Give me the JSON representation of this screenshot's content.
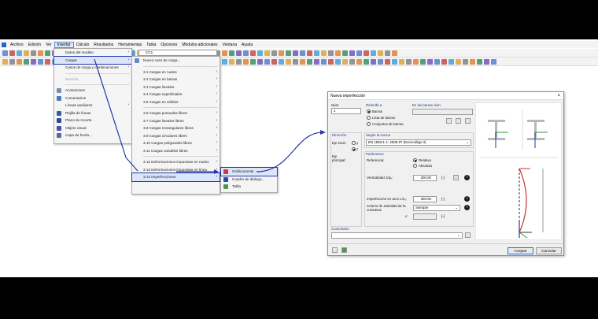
{
  "menubar": [
    "Archivo",
    "Edición",
    "Ver",
    "Insertar",
    "Cálculo",
    "Resultados",
    "Herramientas",
    "Tabla",
    "Opciones",
    "Módulos adicionales",
    "Ventana",
    "Ayuda"
  ],
  "toolbar": {
    "case_value": "CC1"
  },
  "insert_menu": {
    "items": [
      "Datos del modelo",
      "Cargas",
      "Casos de carga y combinaciones",
      "Sección",
      "Acotaciones",
      "Comentarios",
      "Líneas auxiliares",
      "Rejilla de líneas",
      "Plano de recorte",
      "Objeto visual",
      "Capa de fondo..."
    ]
  },
  "cargas_menu": {
    "items": [
      "Nuevo caso de carga...",
      "3.1 Cargas en nudos",
      "3.2 Cargas en barras",
      "3.3 Cargas lineales",
      "3.4 Cargas superficiales",
      "3.5 Cargas en sólidos",
      "3.6 Cargas puntuales libres",
      "3.7 Cargas lineales libres",
      "3.8 Cargas rectangulares libres",
      "3.9 Cargas circulares libres",
      "3.10 Cargas poligonales libres",
      "3.11 Cargas variables libres",
      "3.12 Deformaciones impuestas en nudos",
      "3.13 Deformaciones impuestas en línea",
      "3.14 Imperfecciones"
    ]
  },
  "imperf_menu": {
    "items": [
      "Gráficamente",
      "Cuadro de diálogo...",
      "Tabla"
    ]
  },
  "dialog": {
    "title": "Nueva imperfección",
    "num_label": "Núm.",
    "num_value": "1",
    "ref_label": "Referida a",
    "ref_options": [
      "Barras",
      "Lista de barras",
      "Conjuntos de barras"
    ],
    "barras_label": "En las barras núm.",
    "dir_label": "Dirección",
    "eje_local_label": "Eje local:",
    "eje_opts": [
      "y",
      "z"
    ],
    "eje_principal_label": "Eje principal:",
    "norma_label": "Según la norma",
    "norma_value": "EN 1993-1-1: 2005-07 (Eurocódigo 3)",
    "param_label": "Parámetros",
    "ref2_label": "Referencia:",
    "ref2_opts": [
      "Relativa",
      "Absoluta"
    ],
    "vert_label": "Verticalidad 1/φ₀:",
    "vert_value": "200.00",
    "vert_unit": "[-]",
    "arc_label": "Imperfección en arco L/e₀:",
    "arc_value": "300.00",
    "arc_unit": "[-]",
    "crit_label": "Criterio de actividad de la curvatura:",
    "crit_value": "Siempre",
    "eps_label": "ε:",
    "eps_unit": "[-]",
    "comment_label": "Comentario",
    "ok": "Aceptar",
    "cancel": "Cancelar"
  },
  "colors": {
    "highlight": "#2636a8",
    "accent": "#2b6cd6"
  }
}
